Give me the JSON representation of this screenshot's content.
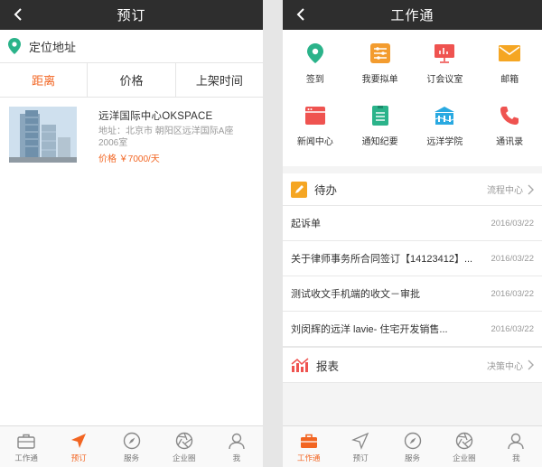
{
  "left": {
    "nav_title": "预订",
    "location_label": "定位地址",
    "sort_tabs": [
      "距离",
      "价格",
      "上架时间"
    ],
    "listing": {
      "name": "远洋国际中心OKSPACE",
      "address": "地址：北京市 朝阳区远洋国际A座2006室",
      "price": "价格 ￥7000/天"
    },
    "tabbar": [
      {
        "label": "工作通",
        "icon": "briefcase-icon"
      },
      {
        "label": "预订",
        "icon": "send-icon"
      },
      {
        "label": "服务",
        "icon": "compass-icon"
      },
      {
        "label": "企业圈",
        "icon": "aperture-icon"
      },
      {
        "label": "我",
        "icon": "person-icon"
      }
    ]
  },
  "right": {
    "nav_title": "工作通",
    "grid": [
      {
        "label": "签到",
        "icon": "location-pin-icon",
        "color": "#2bb38a"
      },
      {
        "label": "我要拟单",
        "icon": "sliders-icon",
        "color": "#f39c2f"
      },
      {
        "label": "订会议室",
        "icon": "presentation-board-icon",
        "color": "#ef5350"
      },
      {
        "label": "邮箱",
        "icon": "mail-icon",
        "color": "#f5a623"
      },
      {
        "label": "新闻中心",
        "icon": "browser-window-icon",
        "color": "#ef5350"
      },
      {
        "label": "通知纪要",
        "icon": "document-icon",
        "color": "#2bb38a"
      },
      {
        "label": "远洋学院",
        "icon": "school-building-icon",
        "color": "#29a9e1"
      },
      {
        "label": "通讯录",
        "icon": "phone-icon",
        "color": "#ef5350"
      }
    ],
    "todo_header": {
      "title": "待办",
      "right": "流程中心"
    },
    "todos": [
      {
        "title": "起诉单",
        "date": "2016/03/22"
      },
      {
        "title": "关于律师事务所合同签订【14123412】...",
        "date": "2016/03/22"
      },
      {
        "title": "测试收文手机端的收文－审批",
        "date": "2016/03/22"
      },
      {
        "title": "刘闵辉的远洋 lavie- 住宅开发销售...",
        "date": "2016/03/22"
      }
    ],
    "report_header": {
      "title": "报表",
      "right": "决策中心"
    },
    "tabbar": [
      {
        "label": "工作通",
        "icon": "briefcase-icon"
      },
      {
        "label": "预订",
        "icon": "send-icon"
      },
      {
        "label": "服务",
        "icon": "compass-icon"
      },
      {
        "label": "企业圈",
        "icon": "aperture-icon"
      },
      {
        "label": "我",
        "icon": "person-icon"
      }
    ]
  },
  "colors": {
    "accent": "#f26522",
    "navbar": "#2e2e2e",
    "pin": "#2bb38a"
  }
}
